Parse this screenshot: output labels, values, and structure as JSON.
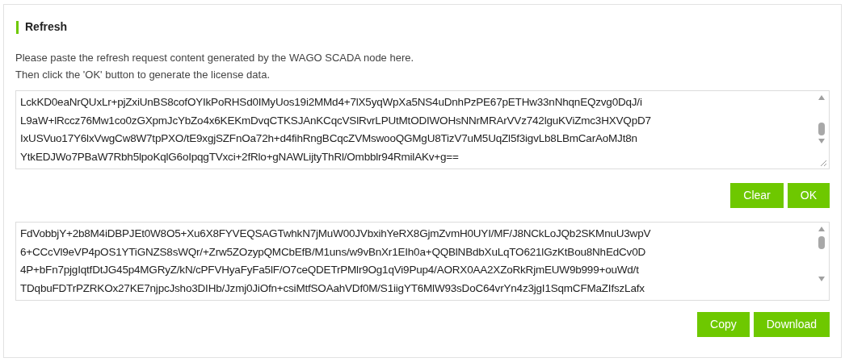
{
  "section": {
    "title": "Refresh"
  },
  "instructions": [
    "Please paste the refresh request content generated by the WAGO SCADA node here.",
    "Then click the 'OK' button to generate the license data."
  ],
  "request_box": {
    "lines": [
      "LckKD0eaNrQUxLr+pjZxiUnBS8cofOYIkPoRHSd0IMyUos19i2MMd4+7lX5yqWpXa5NS4uDnhPzPE67pETHw33nNhqnEQzvg0DqJ/i",
      "L9aW+lRccz76Mw1co0zGXpmJcYbZo4x6KEKmDvqCTKSJAnKCqcVSlRvrLPUtMtODIWOHsNNrMRArVVz742lguKViZmc3HXVQpD7",
      "IxUSVuo17Y6lxVwgCw8W7tpPXO/tE9xgjSZFnOa72h+d4fihRngBCqcZVMswooQGMgU8TizV7uM5UqZl5f3igvLb8LBmCarAoMJt8n",
      "YtkEDJWo7PBaW7Rbh5lpoKqlG6oIpqgTVxci+2fRlo+gNAWLijtyThRl/Ombblr94RmilAKv+g=="
    ]
  },
  "request_buttons": [
    "Clear",
    "OK"
  ],
  "license_box": {
    "lines": [
      "FdVobbjY+2b8M4iDBPJEt0W8O5+Xu6X8FYVEQSAGTwhkN7jMuW00JVbxihYeRX8GjmZvmH0UYI/MF/J8NCkLoJQb2SKMnuU3wpV",
      "6+CCcVl9eVP4pOS1YTiGNZS8sWQr/+Zrw5ZOzypQMCbEfB/M1uns/w9vBnXr1EIh0a+QQBlNBdbXuLqTO621lGzKtBou8NhEdCv0D",
      "4P+bFn7pjgIqtfDtJG45p4MGRyZ/kN/cPFVHyaFyFa5lF/O7ceQDETrPMlr9Og1qVi9Pup4/AORX0AA2XZoRkRjmEUW9b999+ouWd/t",
      "TDqbuFDTrPZRKOx27KE7njpcJsho3DIHb/Jzmj0JiOfn+csiMtfSOAahVDf0M/S1iigYT6MlW93sDoC64vrYn4z3jgI1SqmCFMaZIfszLafx"
    ]
  },
  "license_buttons": [
    "Copy",
    "Download"
  ]
}
